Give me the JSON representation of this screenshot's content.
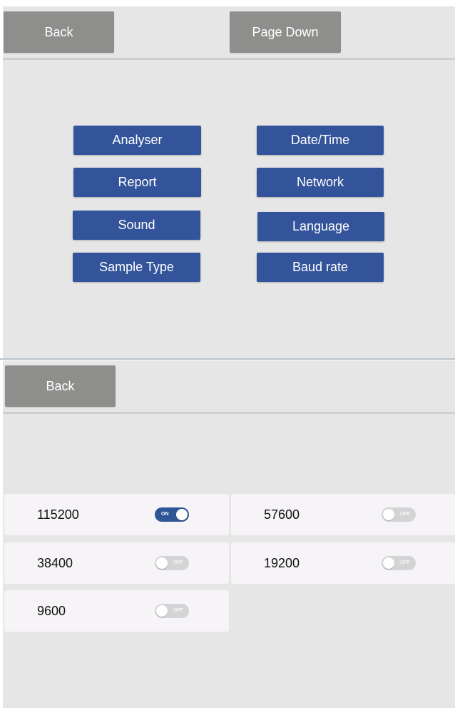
{
  "top_panel": {
    "back_label": "Back",
    "page_down_label": "Page Down",
    "menu": {
      "analyser": "Analyser",
      "date_time": "Date/Time",
      "report": "Report",
      "network": "Network",
      "sound": "Sound",
      "language": "Language",
      "sample_type": "Sample Type",
      "baud_rate": "Baud rate"
    }
  },
  "bottom_panel": {
    "back_label": "Back",
    "baud_rates": [
      {
        "value": "115200",
        "toggle_text": "ON",
        "enabled": true
      },
      {
        "value": "57600",
        "toggle_text": "OFF",
        "enabled": false
      },
      {
        "value": "38400",
        "toggle_text": "OFF",
        "enabled": false
      },
      {
        "value": "19200",
        "toggle_text": "OFF",
        "enabled": false
      },
      {
        "value": "9600",
        "toggle_text": "OFF",
        "enabled": false
      }
    ]
  },
  "colors": {
    "menu_button": "#33549a",
    "gray_button": "#8e8f8c",
    "toggle_on": "#2f5596",
    "toggle_off": "#d4d4d6",
    "background": "#e6e6e6"
  }
}
